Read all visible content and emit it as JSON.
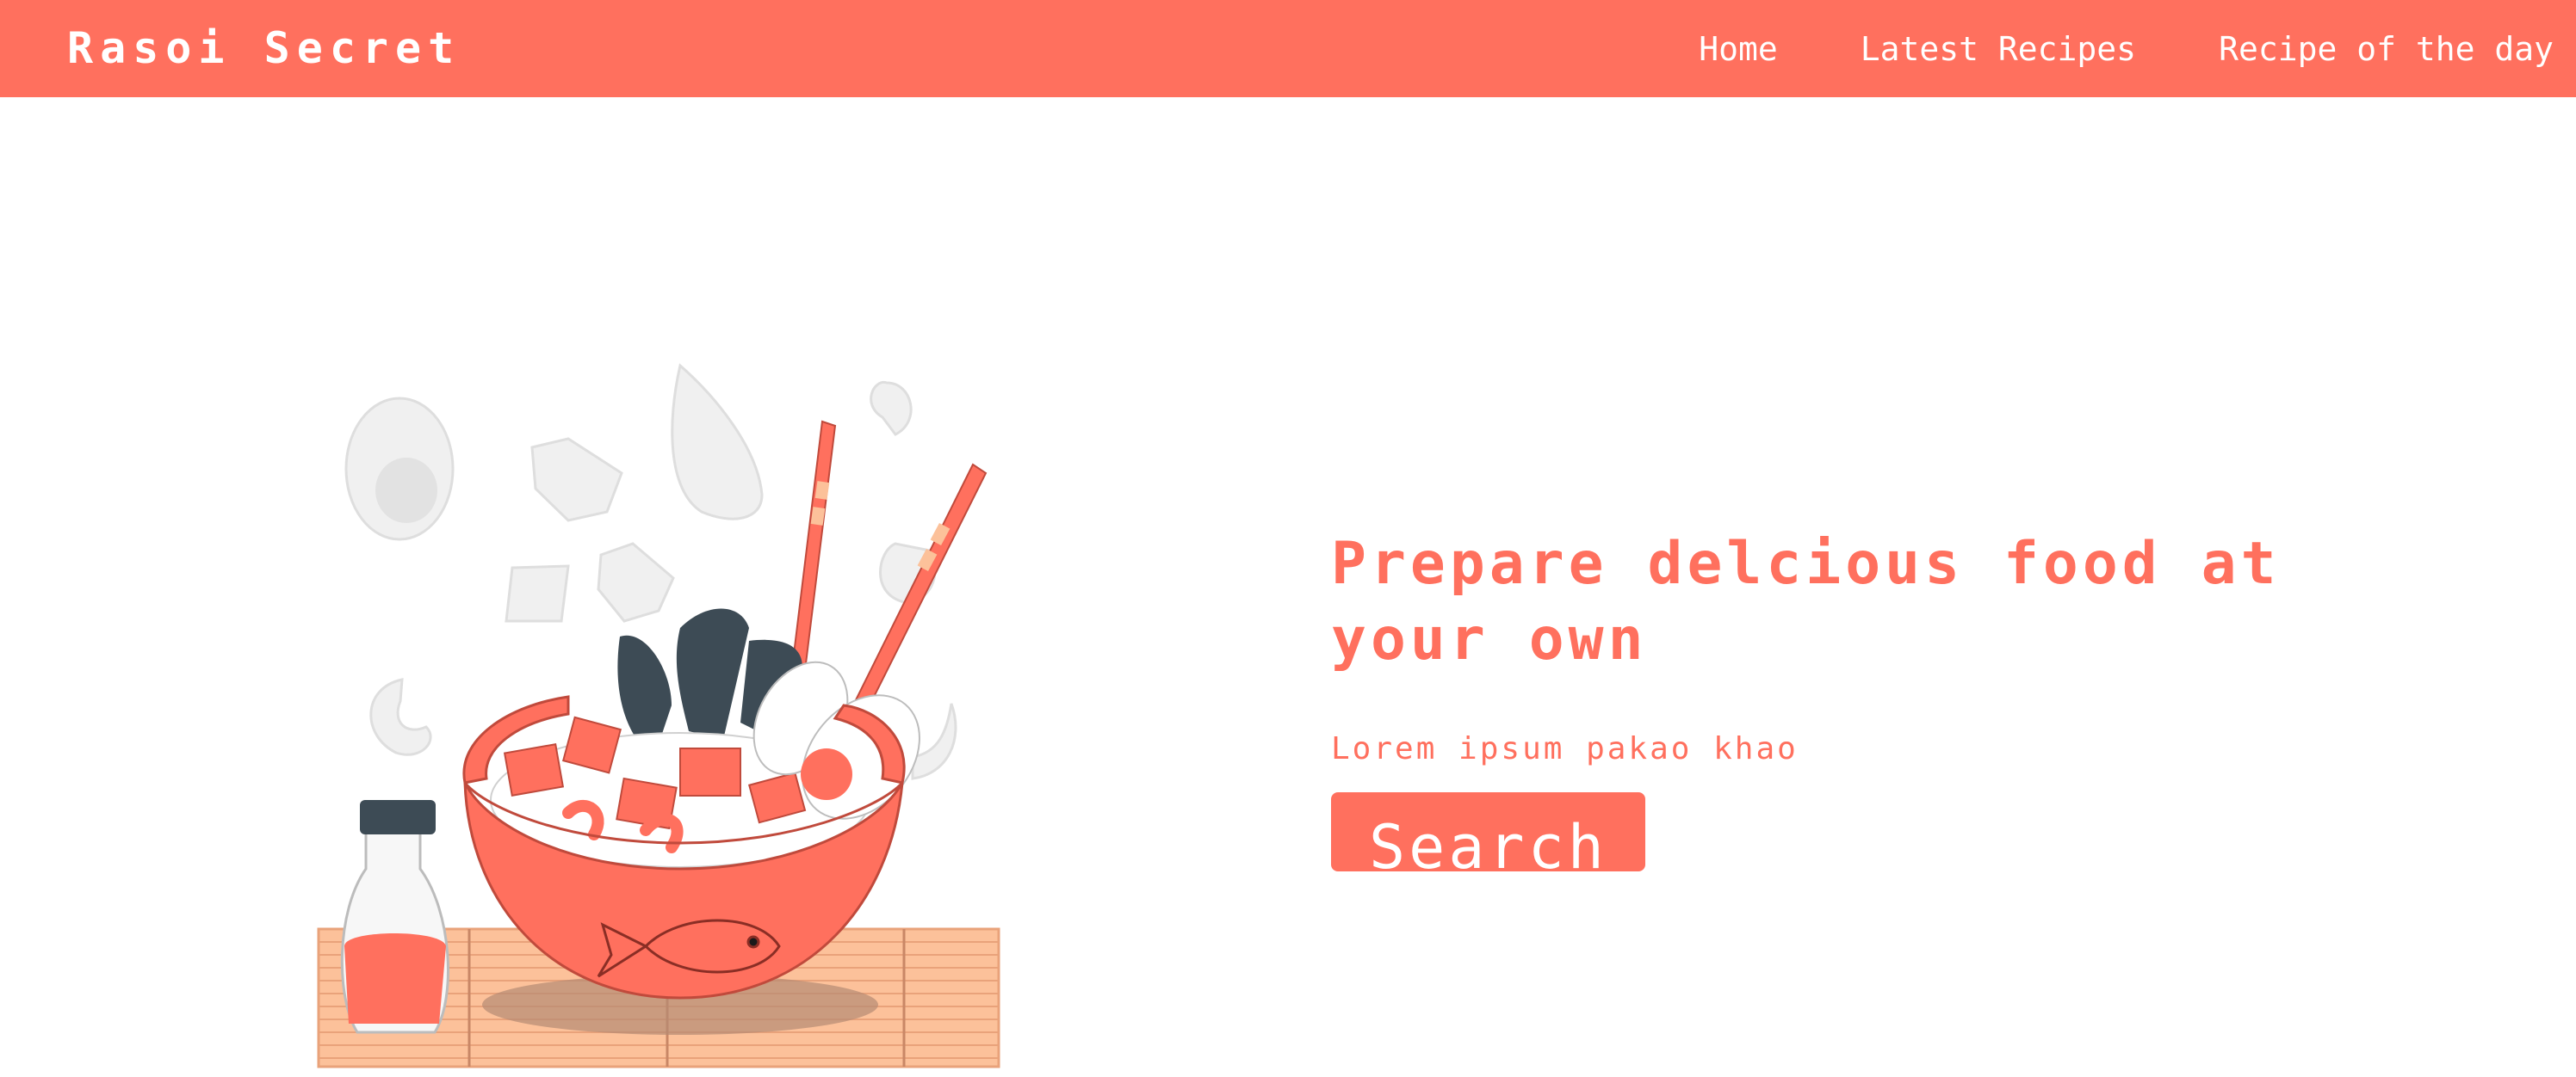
{
  "header": {
    "brand": "Rasoi Secret",
    "nav": [
      {
        "label": "Home"
      },
      {
        "label": "Latest Recipes"
      },
      {
        "label": "Recipe of the day"
      }
    ]
  },
  "hero": {
    "title": "Prepare delcious food at your own",
    "subtitle": "Lorem ipsum pakao khao",
    "search_label": "Search"
  },
  "colors": {
    "accent": "#ff705e",
    "background": "#ffffff",
    "dark": "#3d4b55",
    "mat": "#fcc19a"
  },
  "illustration": {
    "icon": "food-bowl-illustration"
  }
}
